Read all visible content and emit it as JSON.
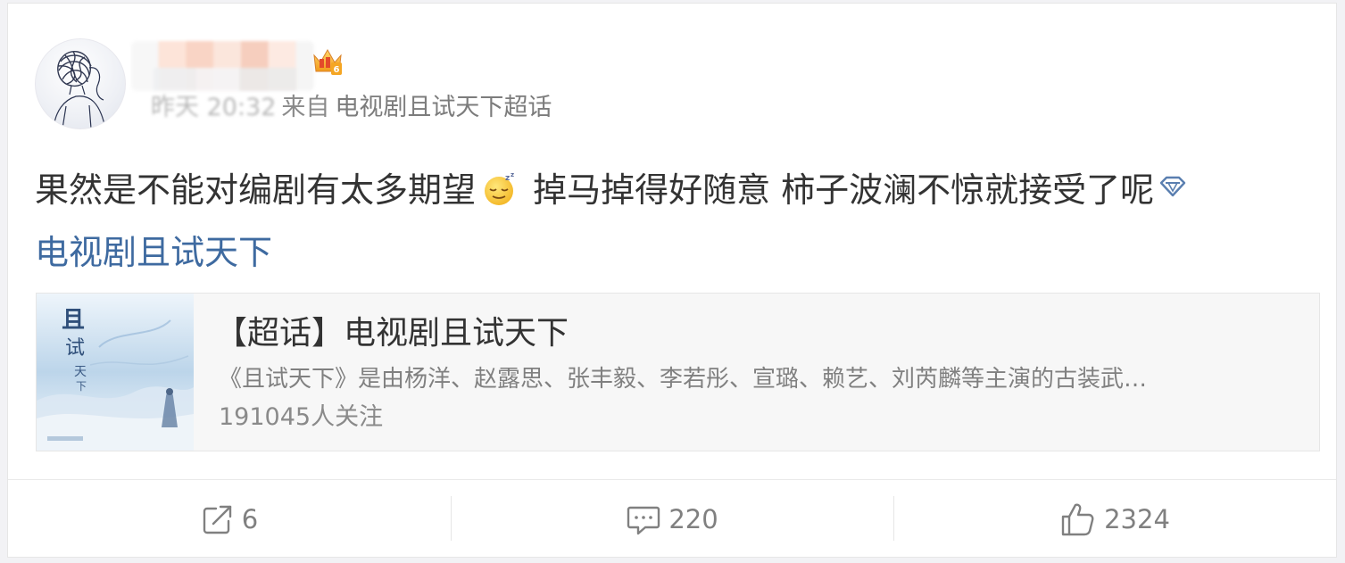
{
  "post": {
    "author": {
      "nickname": "",
      "vip_level": "6"
    },
    "meta": {
      "time": "昨天 20:32",
      "from_label": "来自",
      "source": "电视剧且试天下超话"
    },
    "text_part1": "果然是不能对编剧有太多期望",
    "emoji_name": "sleepy-emoji",
    "text_part2": " 掉马掉得好随意 柿子波澜不惊就接受了呢",
    "topic_link": "电视剧且试天下",
    "topic_card": {
      "title": "【超话】电视剧且试天下",
      "description": "《且试天下》是由杨洋、赵露思、张丰毅、李若彤、宣璐、赖艺、刘芮麟等主演的古装武…",
      "followers": "191045人关注",
      "cover_text": "且试天下"
    }
  },
  "actions": {
    "repost_count": "6",
    "comment_count": "220",
    "like_count": "2324"
  },
  "colors": {
    "link": "#3e6aa0",
    "text": "#333333",
    "muted": "#808080",
    "card_bg": "#f7f7f7"
  }
}
